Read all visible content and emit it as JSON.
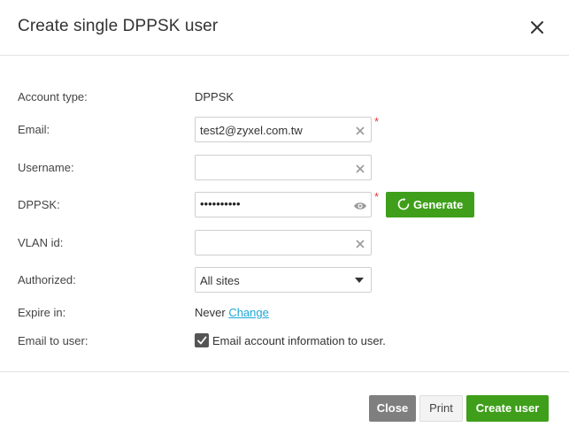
{
  "dialog": {
    "title": "Create single DPPSK user",
    "close_icon": "close-icon"
  },
  "form": {
    "account_type": {
      "label": "Account type:",
      "value": "DPPSK"
    },
    "email": {
      "label": "Email:",
      "value": "test2@zyxel.com.tw",
      "required_mark": "*"
    },
    "username": {
      "label": "Username:",
      "value": ""
    },
    "dppsk": {
      "label": "DPPSK:",
      "masked_value": "••••••••••",
      "required_mark": "*",
      "icon": "eye-icon"
    },
    "generate_button": {
      "label": "Generate",
      "icon": "refresh-icon"
    },
    "vlan_id": {
      "label": "VLAN id:",
      "value": ""
    },
    "authorized": {
      "label": "Authorized:",
      "selected": "All sites"
    },
    "expire_in": {
      "label": "Expire in:",
      "value": "Never",
      "change_link": "Change"
    },
    "email_to_user": {
      "label": "Email to user:",
      "checked": true,
      "checkbox_label": "Email account information to user."
    }
  },
  "footer": {
    "close_label": "Close",
    "print_label": "Print",
    "create_label": "Create user"
  },
  "colors": {
    "accent_green": "#3f9f1a",
    "required_red": "#e53935",
    "link_blue": "#1ea7d6",
    "close_gray": "#7f7f7f"
  }
}
